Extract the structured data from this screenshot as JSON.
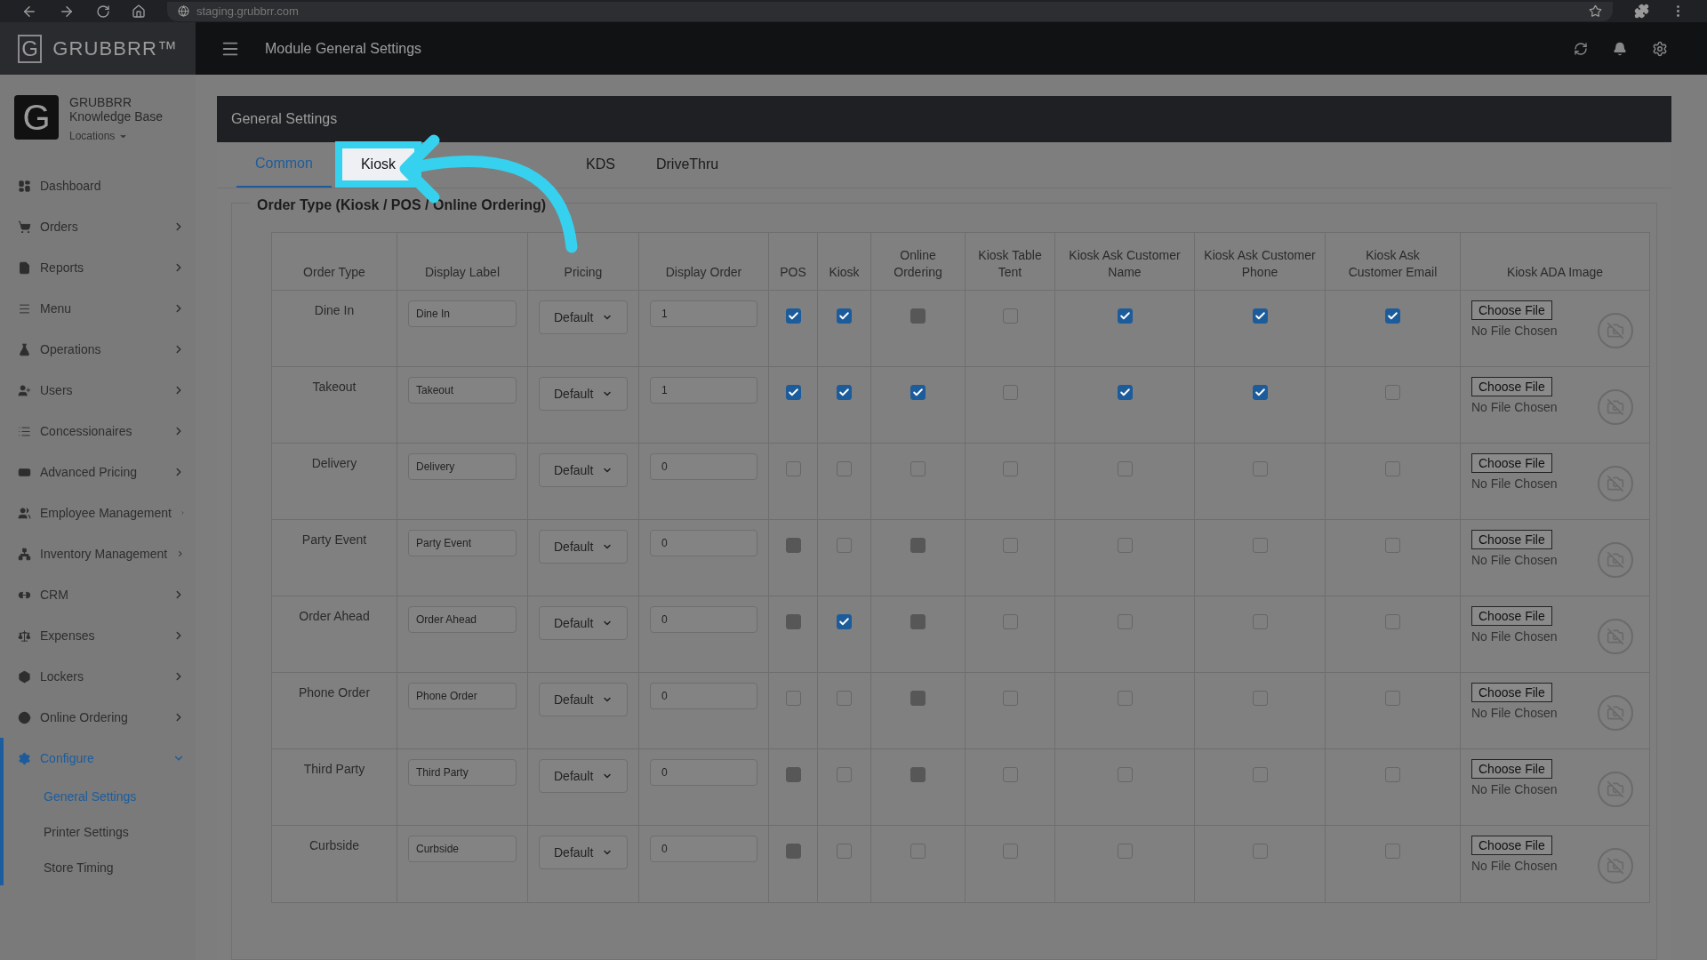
{
  "browser": {
    "url": "staging.grubbrr.com"
  },
  "brand": {
    "logo_letter": "G",
    "name": "GRUBBRR™"
  },
  "topbar": {
    "title": "Module General Settings"
  },
  "account": {
    "avatar_letter": "G",
    "name_line1": "GRUBBRR",
    "name_line2": "Knowledge Base",
    "locations": "Locations"
  },
  "sidebar": {
    "items": [
      {
        "label": "Dashboard",
        "has_children": false,
        "expanded": false,
        "selected": false
      },
      {
        "label": "Orders",
        "has_children": true,
        "expanded": false,
        "selected": false
      },
      {
        "label": "Reports",
        "has_children": true,
        "expanded": false,
        "selected": false
      },
      {
        "label": "Menu",
        "has_children": true,
        "expanded": false,
        "selected": false
      },
      {
        "label": "Operations",
        "has_children": true,
        "expanded": false,
        "selected": false
      },
      {
        "label": "Users",
        "has_children": true,
        "expanded": false,
        "selected": false
      },
      {
        "label": "Concessionaires",
        "has_children": true,
        "expanded": false,
        "selected": false
      },
      {
        "label": "Advanced Pricing",
        "has_children": true,
        "expanded": false,
        "selected": false
      },
      {
        "label": "Employee Management",
        "has_children": true,
        "expanded": false,
        "selected": false
      },
      {
        "label": "Inventory Management",
        "has_children": true,
        "expanded": false,
        "selected": false
      },
      {
        "label": "CRM",
        "has_children": true,
        "expanded": false,
        "selected": false
      },
      {
        "label": "Expenses",
        "has_children": true,
        "expanded": false,
        "selected": false
      },
      {
        "label": "Lockers",
        "has_children": true,
        "expanded": false,
        "selected": false
      },
      {
        "label": "Online Ordering",
        "has_children": true,
        "expanded": false,
        "selected": false
      },
      {
        "label": "Configure",
        "has_children": true,
        "expanded": true,
        "selected": true,
        "children": [
          {
            "label": "General Settings",
            "selected": true
          },
          {
            "label": "Printer Settings",
            "selected": false
          },
          {
            "label": "Store Timing",
            "selected": false
          }
        ]
      }
    ]
  },
  "panel": {
    "title": "General Settings"
  },
  "tabs": [
    {
      "label": "Common",
      "selected": true,
      "highlighted": false
    },
    {
      "label": "Kiosk",
      "selected": false,
      "highlighted": true
    },
    {
      "label": "KDS",
      "selected": false,
      "highlighted": false
    },
    {
      "label": "DriveThru",
      "selected": false,
      "highlighted": false
    }
  ],
  "section": {
    "title": "Order Type (Kiosk / POS / Online Ordering)"
  },
  "table": {
    "columns": [
      {
        "line1": "Order Type"
      },
      {
        "line1": "Display Label"
      },
      {
        "line1": "Pricing"
      },
      {
        "line1": "Display Order"
      },
      {
        "line1": "POS"
      },
      {
        "line1": "Kiosk"
      },
      {
        "line1": "Online",
        "line2": "Ordering"
      },
      {
        "line1": "Kiosk Table",
        "line2": "Tent"
      },
      {
        "line1": "Kiosk Ask Customer",
        "line2": "Name"
      },
      {
        "line1": "Kiosk Ask Customer",
        "line2": "Phone"
      },
      {
        "line1": "Kiosk Ask",
        "line2": "Customer Email"
      },
      {
        "line1": "Kiosk ADA Image"
      }
    ],
    "rows": [
      {
        "order_type": "Dine In",
        "label": "Dine In",
        "pricing": "Default",
        "display_order": "1",
        "checks": [
          {
            "checked": true,
            "disabled": false
          },
          {
            "checked": true,
            "disabled": false
          },
          {
            "checked": false,
            "disabled": true
          },
          {
            "checked": false,
            "disabled": false
          },
          {
            "checked": true,
            "disabled": false
          },
          {
            "checked": true,
            "disabled": false
          },
          {
            "checked": true,
            "disabled": false
          }
        ],
        "file_button": "Choose File",
        "file_status": "No File Chosen"
      },
      {
        "order_type": "Takeout",
        "label": "Takeout",
        "pricing": "Default",
        "display_order": "1",
        "checks": [
          {
            "checked": true,
            "disabled": false
          },
          {
            "checked": true,
            "disabled": false
          },
          {
            "checked": true,
            "disabled": false
          },
          {
            "checked": false,
            "disabled": false
          },
          {
            "checked": true,
            "disabled": false
          },
          {
            "checked": true,
            "disabled": false
          },
          {
            "checked": false,
            "disabled": false
          }
        ],
        "file_button": "Choose File",
        "file_status": "No File Chosen"
      },
      {
        "order_type": "Delivery",
        "label": "Delivery",
        "pricing": "Default",
        "display_order": "0",
        "checks": [
          {
            "checked": false,
            "disabled": false
          },
          {
            "checked": false,
            "disabled": false
          },
          {
            "checked": false,
            "disabled": false
          },
          {
            "checked": false,
            "disabled": false
          },
          {
            "checked": false,
            "disabled": false
          },
          {
            "checked": false,
            "disabled": false
          },
          {
            "checked": false,
            "disabled": false
          }
        ],
        "file_button": "Choose File",
        "file_status": "No File Chosen"
      },
      {
        "order_type": "Party Event",
        "label": "Party Event",
        "pricing": "Default",
        "display_order": "0",
        "checks": [
          {
            "checked": false,
            "disabled": true
          },
          {
            "checked": false,
            "disabled": false
          },
          {
            "checked": false,
            "disabled": true
          },
          {
            "checked": false,
            "disabled": false
          },
          {
            "checked": false,
            "disabled": false
          },
          {
            "checked": false,
            "disabled": false
          },
          {
            "checked": false,
            "disabled": false
          }
        ],
        "file_button": "Choose File",
        "file_status": "No File Chosen"
      },
      {
        "order_type": "Order Ahead",
        "label": "Order Ahead",
        "pricing": "Default",
        "display_order": "0",
        "checks": [
          {
            "checked": false,
            "disabled": true
          },
          {
            "checked": true,
            "disabled": false
          },
          {
            "checked": false,
            "disabled": true
          },
          {
            "checked": false,
            "disabled": false
          },
          {
            "checked": false,
            "disabled": false
          },
          {
            "checked": false,
            "disabled": false
          },
          {
            "checked": false,
            "disabled": false
          }
        ],
        "file_button": "Choose File",
        "file_status": "No File Chosen"
      },
      {
        "order_type": "Phone Order",
        "label": "Phone Order",
        "pricing": "Default",
        "display_order": "0",
        "checks": [
          {
            "checked": false,
            "disabled": false
          },
          {
            "checked": false,
            "disabled": false
          },
          {
            "checked": false,
            "disabled": true
          },
          {
            "checked": false,
            "disabled": false
          },
          {
            "checked": false,
            "disabled": false
          },
          {
            "checked": false,
            "disabled": false
          },
          {
            "checked": false,
            "disabled": false
          }
        ],
        "file_button": "Choose File",
        "file_status": "No File Chosen"
      },
      {
        "order_type": "Third Party",
        "label": "Third Party",
        "pricing": "Default",
        "display_order": "0",
        "checks": [
          {
            "checked": false,
            "disabled": true
          },
          {
            "checked": false,
            "disabled": false
          },
          {
            "checked": false,
            "disabled": true
          },
          {
            "checked": false,
            "disabled": false
          },
          {
            "checked": false,
            "disabled": false
          },
          {
            "checked": false,
            "disabled": false
          },
          {
            "checked": false,
            "disabled": false
          }
        ],
        "file_button": "Choose File",
        "file_status": "No File Chosen"
      },
      {
        "order_type": "Curbside",
        "label": "Curbside",
        "pricing": "Default",
        "display_order": "0",
        "checks": [
          {
            "checked": false,
            "disabled": true
          },
          {
            "checked": false,
            "disabled": false
          },
          {
            "checked": false,
            "disabled": false
          },
          {
            "checked": false,
            "disabled": false
          },
          {
            "checked": false,
            "disabled": false
          },
          {
            "checked": false,
            "disabled": false
          },
          {
            "checked": false,
            "disabled": false
          }
        ],
        "file_button": "Choose File",
        "file_status": "No File Chosen"
      }
    ]
  }
}
